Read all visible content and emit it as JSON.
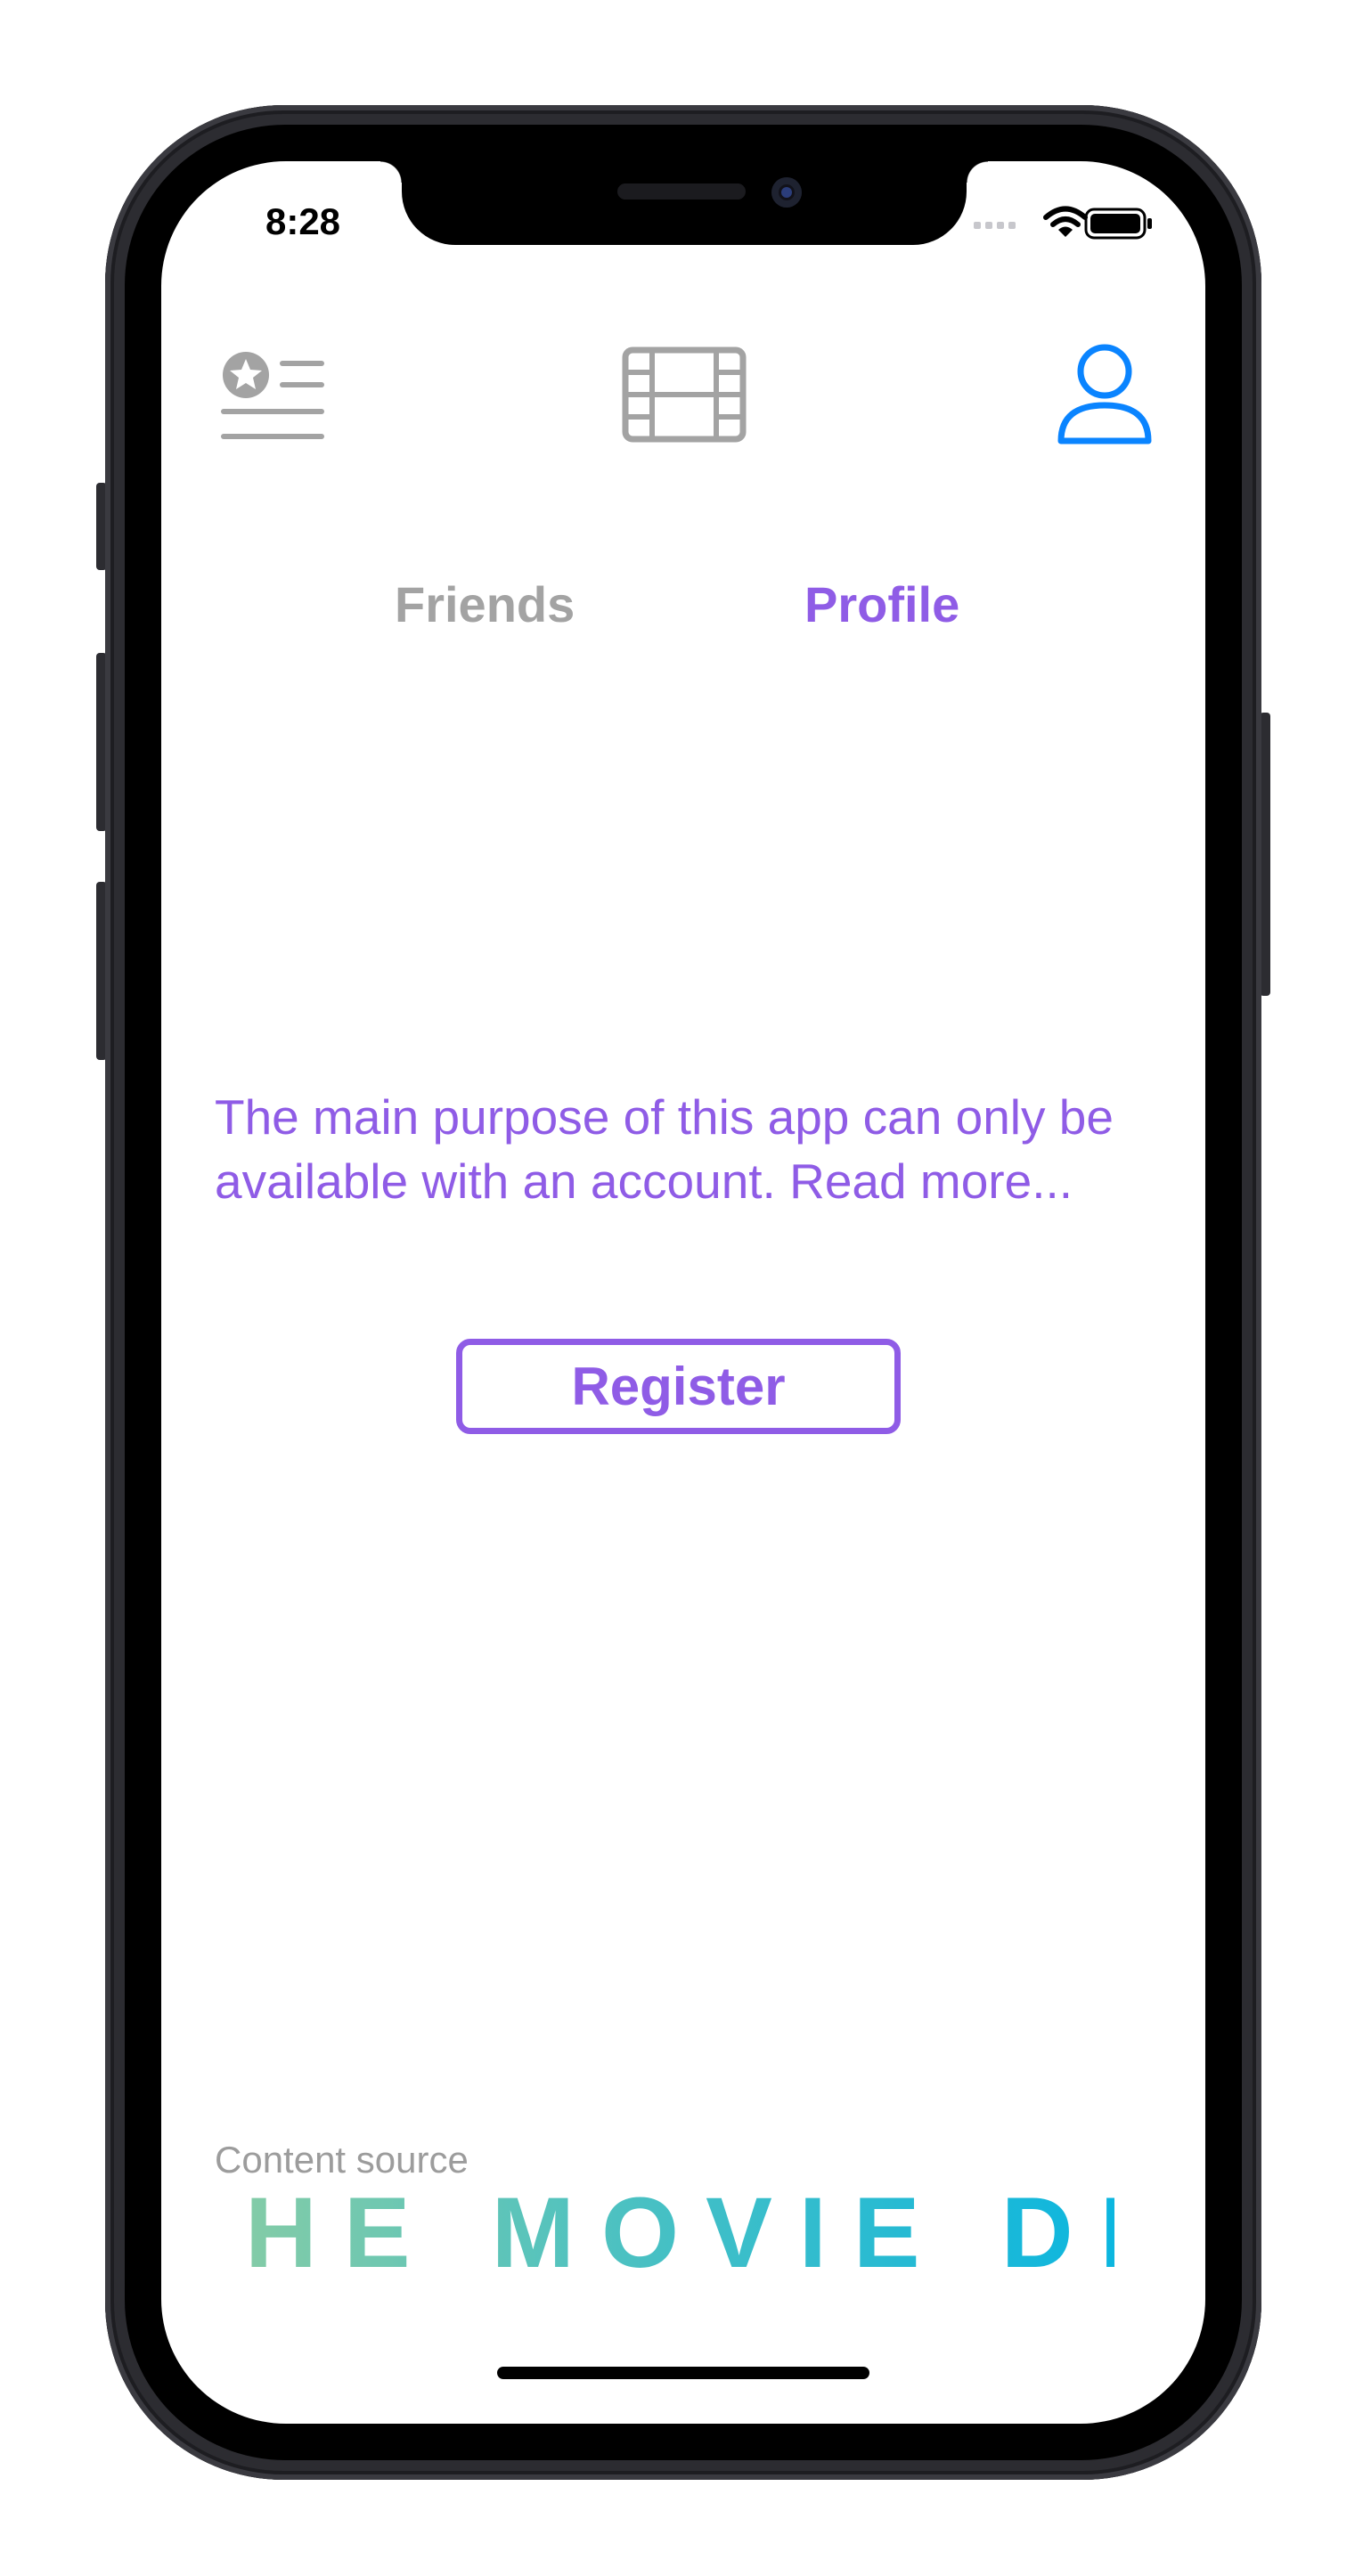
{
  "status_bar": {
    "time": "8:28"
  },
  "nav": {
    "left_icon": "watchlist-icon",
    "center_icon": "film-icon",
    "right_icon": "profile-icon",
    "active_color": "#0a84ff",
    "inactive_color": "#a3a3a3"
  },
  "segments": {
    "friends": "Friends",
    "profile": "Profile",
    "selected": "Profile"
  },
  "main": {
    "message": "The main purpose of this app can only be available with an account. Read more...",
    "register_label": "Register"
  },
  "footer": {
    "source_label": "Content source",
    "logo_text": "THE MOVIE DB"
  },
  "colors": {
    "accent": "#8f5ce6",
    "logo_gradient_start": "#90cea1",
    "logo_gradient_end": "#01b4e4"
  }
}
